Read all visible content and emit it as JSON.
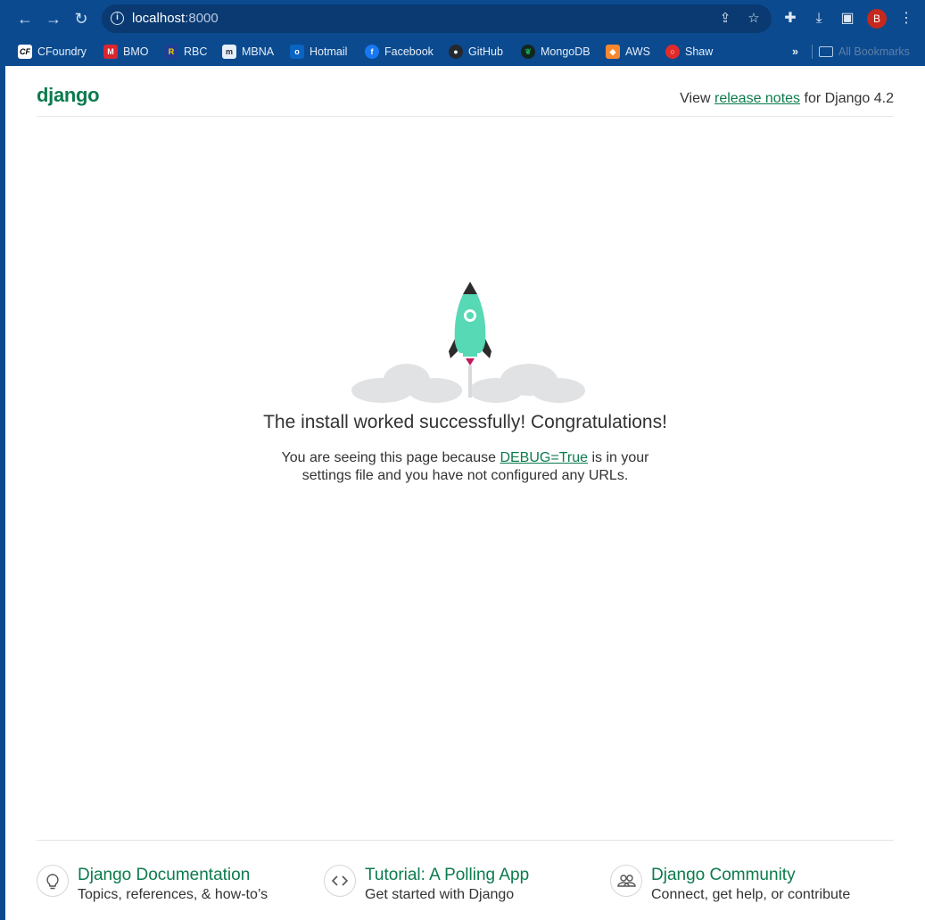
{
  "browser": {
    "url_host": "localhost",
    "url_port": ":8000",
    "profile_initial": "B",
    "colors": {
      "chrome": "#0b4a8f",
      "omnibox": "#0a3a71",
      "avatar": "#c5281c"
    }
  },
  "bookmarks": {
    "items": [
      {
        "label": "CFoundry",
        "icon": "cf-icon",
        "glyph": "CF",
        "color": "#ffffff"
      },
      {
        "label": "BMO",
        "icon": "bmo-icon",
        "glyph": "M",
        "color": "#d9262f"
      },
      {
        "label": "RBC",
        "icon": "rbc-icon",
        "glyph": "R",
        "color": "#1c3f94"
      },
      {
        "label": "MBNA",
        "icon": "mbna-icon",
        "glyph": "m",
        "color": "#2a2a2a"
      },
      {
        "label": "Hotmail",
        "icon": "outlook-icon",
        "glyph": "o",
        "color": "#0a64c2"
      },
      {
        "label": "Facebook",
        "icon": "facebook-icon",
        "glyph": "f",
        "color": "#1877f2"
      },
      {
        "label": "GitHub",
        "icon": "github-icon",
        "glyph": "◉",
        "color": "#24292f"
      },
      {
        "label": "MongoDB",
        "icon": "mongodb-icon",
        "glyph": "❦",
        "color": "#13aa52"
      },
      {
        "label": "AWS",
        "icon": "aws-icon",
        "glyph": "◆",
        "color": "#f7882f"
      },
      {
        "label": "Shaw",
        "icon": "shaw-icon",
        "glyph": "◯",
        "color": "#e12a2a"
      }
    ],
    "overflow": "»",
    "all_bookmarks": "All Bookmarks"
  },
  "page": {
    "brand": "django",
    "release_prefix": "View ",
    "release_link": "release notes",
    "release_suffix": " for Django 4.2",
    "headline": "The install worked successfully! Congratulations!",
    "sub_prefix": "You are seeing this page because ",
    "sub_link": "DEBUG=True",
    "sub_suffix": " is in your settings file and you have not configured any URLs.",
    "accent": "#0c7b4d"
  },
  "footer": {
    "cards": [
      {
        "title": "Django Documentation",
        "subtitle": "Topics, references, & how-to’s",
        "icon": "lightbulb-icon"
      },
      {
        "title": "Tutorial: A Polling App",
        "subtitle": "Get started with Django",
        "icon": "code-icon"
      },
      {
        "title": "Django Community",
        "subtitle": "Connect, get help, or contribute",
        "icon": "people-icon"
      }
    ]
  }
}
